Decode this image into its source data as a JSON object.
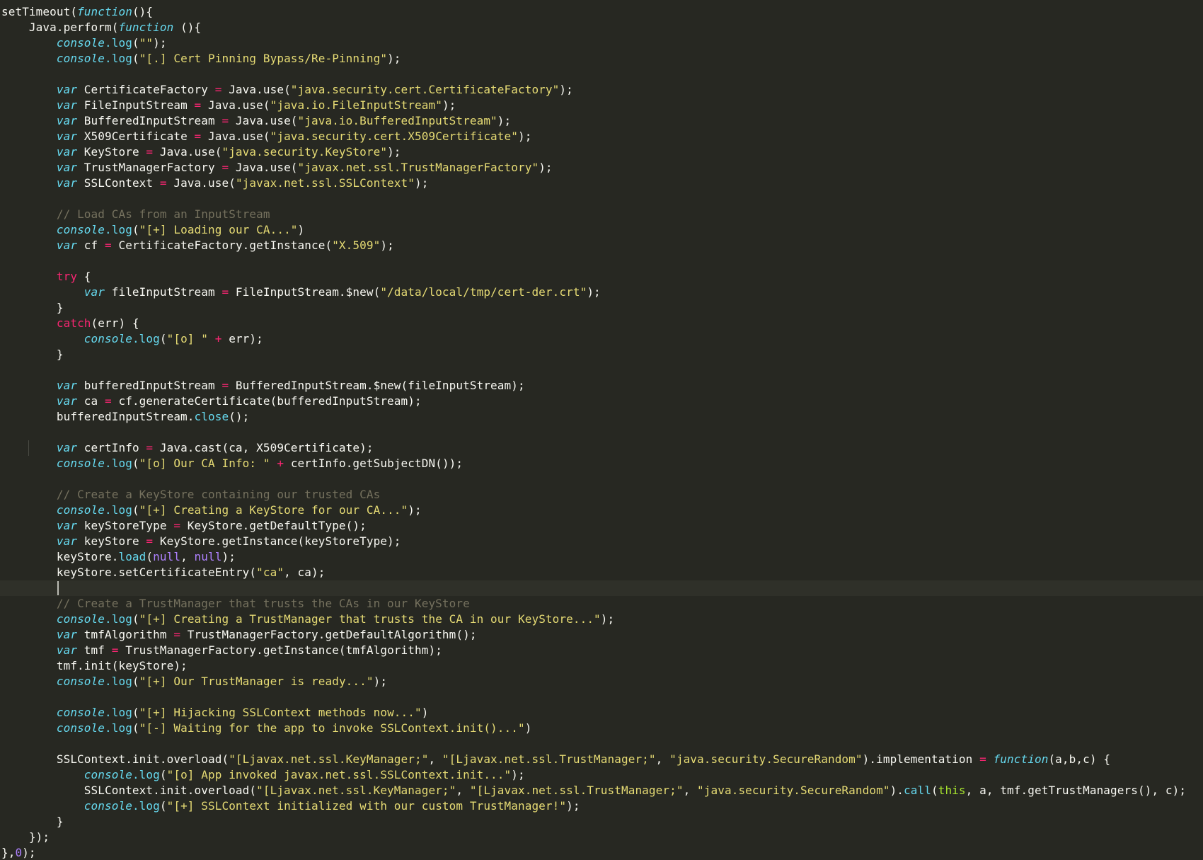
{
  "editor": {
    "theme_colors": {
      "background": "#272822",
      "current_line": "#2f3029",
      "text": "#f8f8f2",
      "string": "#e6db74",
      "storage": "#66d9ef",
      "keyword": "#f92672",
      "comment": "#75715e",
      "constant": "#ae81ff",
      "this": "#a6e22e"
    },
    "current_line_index": 37,
    "lines": [
      [
        [
          "plain",
          "setTimeout("
        ],
        [
          "storage",
          "function"
        ],
        [
          "plain",
          "(){"
        ]
      ],
      [
        [
          "plain",
          "    Java.perform("
        ],
        [
          "storage",
          "function"
        ],
        [
          "plain",
          " (){"
        ]
      ],
      [
        [
          "plain",
          "        "
        ],
        [
          "storage",
          "console"
        ],
        [
          "support",
          ".log"
        ],
        [
          "plain",
          "("
        ],
        [
          "str",
          "\"\""
        ],
        [
          "plain",
          ");"
        ]
      ],
      [
        [
          "plain",
          "        "
        ],
        [
          "storage",
          "console"
        ],
        [
          "support",
          ".log"
        ],
        [
          "plain",
          "("
        ],
        [
          "str",
          "\"[.] Cert Pinning Bypass/Re-Pinning\""
        ],
        [
          "plain",
          ");"
        ]
      ],
      [],
      [
        [
          "plain",
          "        "
        ],
        [
          "storage",
          "var"
        ],
        [
          "plain",
          " CertificateFactory "
        ],
        [
          "op",
          "="
        ],
        [
          "plain",
          " Java.use("
        ],
        [
          "str",
          "\"java.security.cert.CertificateFactory\""
        ],
        [
          "plain",
          ");"
        ]
      ],
      [
        [
          "plain",
          "        "
        ],
        [
          "storage",
          "var"
        ],
        [
          "plain",
          " FileInputStream "
        ],
        [
          "op",
          "="
        ],
        [
          "plain",
          " Java.use("
        ],
        [
          "str",
          "\"java.io.FileInputStream\""
        ],
        [
          "plain",
          ");"
        ]
      ],
      [
        [
          "plain",
          "        "
        ],
        [
          "storage",
          "var"
        ],
        [
          "plain",
          " BufferedInputStream "
        ],
        [
          "op",
          "="
        ],
        [
          "plain",
          " Java.use("
        ],
        [
          "str",
          "\"java.io.BufferedInputStream\""
        ],
        [
          "plain",
          ");"
        ]
      ],
      [
        [
          "plain",
          "        "
        ],
        [
          "storage",
          "var"
        ],
        [
          "plain",
          " X509Certificate "
        ],
        [
          "op",
          "="
        ],
        [
          "plain",
          " Java.use("
        ],
        [
          "str",
          "\"java.security.cert.X509Certificate\""
        ],
        [
          "plain",
          ");"
        ]
      ],
      [
        [
          "plain",
          "        "
        ],
        [
          "storage",
          "var"
        ],
        [
          "plain",
          " KeyStore "
        ],
        [
          "op",
          "="
        ],
        [
          "plain",
          " Java.use("
        ],
        [
          "str",
          "\"java.security.KeyStore\""
        ],
        [
          "plain",
          ");"
        ]
      ],
      [
        [
          "plain",
          "        "
        ],
        [
          "storage",
          "var"
        ],
        [
          "plain",
          " TrustManagerFactory "
        ],
        [
          "op",
          "="
        ],
        [
          "plain",
          " Java.use("
        ],
        [
          "str",
          "\"javax.net.ssl.TrustManagerFactory\""
        ],
        [
          "plain",
          ");"
        ]
      ],
      [
        [
          "plain",
          "        "
        ],
        [
          "storage",
          "var"
        ],
        [
          "plain",
          " SSLContext "
        ],
        [
          "op",
          "="
        ],
        [
          "plain",
          " Java.use("
        ],
        [
          "str",
          "\"javax.net.ssl.SSLContext\""
        ],
        [
          "plain",
          ");"
        ]
      ],
      [],
      [
        [
          "plain",
          "        "
        ],
        [
          "comment",
          "// Load CAs from an InputStream"
        ]
      ],
      [
        [
          "plain",
          "        "
        ],
        [
          "storage",
          "console"
        ],
        [
          "support",
          ".log"
        ],
        [
          "plain",
          "("
        ],
        [
          "str",
          "\"[+] Loading our CA...\""
        ],
        [
          "plain",
          ")"
        ]
      ],
      [
        [
          "plain",
          "        "
        ],
        [
          "storage",
          "var"
        ],
        [
          "plain",
          " cf "
        ],
        [
          "op",
          "="
        ],
        [
          "plain",
          " CertificateFactory.getInstance("
        ],
        [
          "str",
          "\"X.509\""
        ],
        [
          "plain",
          ");"
        ]
      ],
      [],
      [
        [
          "plain",
          "        "
        ],
        [
          "keyword",
          "try"
        ],
        [
          "plain",
          " {"
        ]
      ],
      [
        [
          "plain",
          "            "
        ],
        [
          "storage",
          "var"
        ],
        [
          "plain",
          " fileInputStream "
        ],
        [
          "op",
          "="
        ],
        [
          "plain",
          " FileInputStream.$new("
        ],
        [
          "str",
          "\"/data/local/tmp/cert-der.crt\""
        ],
        [
          "plain",
          ");"
        ]
      ],
      [
        [
          "plain",
          "        }"
        ]
      ],
      [
        [
          "plain",
          "        "
        ],
        [
          "keyword",
          "catch"
        ],
        [
          "plain",
          "(err) {"
        ]
      ],
      [
        [
          "plain",
          "            "
        ],
        [
          "storage",
          "console"
        ],
        [
          "support",
          ".log"
        ],
        [
          "plain",
          "("
        ],
        [
          "str",
          "\"[o] \""
        ],
        [
          "plain",
          " "
        ],
        [
          "op",
          "+"
        ],
        [
          "plain",
          " err);"
        ]
      ],
      [
        [
          "plain",
          "        }"
        ]
      ],
      [],
      [
        [
          "plain",
          "        "
        ],
        [
          "storage",
          "var"
        ],
        [
          "plain",
          " bufferedInputStream "
        ],
        [
          "op",
          "="
        ],
        [
          "plain",
          " BufferedInputStream.$new(fileInputStream);"
        ]
      ],
      [
        [
          "plain",
          "        "
        ],
        [
          "storage",
          "var"
        ],
        [
          "plain",
          " ca "
        ],
        [
          "op",
          "="
        ],
        [
          "plain",
          " cf.generateCertificate(bufferedInputStream);"
        ]
      ],
      [
        [
          "plain",
          "        bufferedInputStream."
        ],
        [
          "support",
          "close"
        ],
        [
          "plain",
          "();"
        ]
      ],
      [],
      [
        [
          "plain",
          "        "
        ],
        [
          "storage",
          "var"
        ],
        [
          "plain",
          " certInfo "
        ],
        [
          "op",
          "="
        ],
        [
          "plain",
          " Java.cast(ca, X509Certificate);"
        ]
      ],
      [
        [
          "plain",
          "        "
        ],
        [
          "storage",
          "console"
        ],
        [
          "support",
          ".log"
        ],
        [
          "plain",
          "("
        ],
        [
          "str",
          "\"[o] Our CA Info: \""
        ],
        [
          "plain",
          " "
        ],
        [
          "op",
          "+"
        ],
        [
          "plain",
          " certInfo.getSubjectDN());"
        ]
      ],
      [],
      [
        [
          "plain",
          "        "
        ],
        [
          "comment",
          "// Create a KeyStore containing our trusted CAs"
        ]
      ],
      [
        [
          "plain",
          "        "
        ],
        [
          "storage",
          "console"
        ],
        [
          "support",
          ".log"
        ],
        [
          "plain",
          "("
        ],
        [
          "str",
          "\"[+] Creating a KeyStore for our CA...\""
        ],
        [
          "plain",
          ");"
        ]
      ],
      [
        [
          "plain",
          "        "
        ],
        [
          "storage",
          "var"
        ],
        [
          "plain",
          " keyStoreType "
        ],
        [
          "op",
          "="
        ],
        [
          "plain",
          " KeyStore.getDefaultType();"
        ]
      ],
      [
        [
          "plain",
          "        "
        ],
        [
          "storage",
          "var"
        ],
        [
          "plain",
          " keyStore "
        ],
        [
          "op",
          "="
        ],
        [
          "plain",
          " KeyStore.getInstance(keyStoreType);"
        ]
      ],
      [
        [
          "plain",
          "        keyStore."
        ],
        [
          "support",
          "load"
        ],
        [
          "plain",
          "("
        ],
        [
          "const",
          "null"
        ],
        [
          "plain",
          ", "
        ],
        [
          "const",
          "null"
        ],
        [
          "plain",
          ");"
        ]
      ],
      [
        [
          "plain",
          "        keyStore.setCertificateEntry("
        ],
        [
          "str",
          "\"ca\""
        ],
        [
          "plain",
          ", ca);"
        ]
      ],
      [],
      [
        [
          "plain",
          "        "
        ],
        [
          "comment",
          "// Create a TrustManager that trusts the CAs in our KeyStore"
        ]
      ],
      [
        [
          "plain",
          "        "
        ],
        [
          "storage",
          "console"
        ],
        [
          "support",
          ".log"
        ],
        [
          "plain",
          "("
        ],
        [
          "str",
          "\"[+] Creating a TrustManager that trusts the CA in our KeyStore...\""
        ],
        [
          "plain",
          ");"
        ]
      ],
      [
        [
          "plain",
          "        "
        ],
        [
          "storage",
          "var"
        ],
        [
          "plain",
          " tmfAlgorithm "
        ],
        [
          "op",
          "="
        ],
        [
          "plain",
          " TrustManagerFactory.getDefaultAlgorithm();"
        ]
      ],
      [
        [
          "plain",
          "        "
        ],
        [
          "storage",
          "var"
        ],
        [
          "plain",
          " tmf "
        ],
        [
          "op",
          "="
        ],
        [
          "plain",
          " TrustManagerFactory.getInstance(tmfAlgorithm);"
        ]
      ],
      [
        [
          "plain",
          "        tmf.init(keyStore);"
        ]
      ],
      [
        [
          "plain",
          "        "
        ],
        [
          "storage",
          "console"
        ],
        [
          "support",
          ".log"
        ],
        [
          "plain",
          "("
        ],
        [
          "str",
          "\"[+] Our TrustManager is ready...\""
        ],
        [
          "plain",
          ");"
        ]
      ],
      [],
      [
        [
          "plain",
          "        "
        ],
        [
          "storage",
          "console"
        ],
        [
          "support",
          ".log"
        ],
        [
          "plain",
          "("
        ],
        [
          "str",
          "\"[+] Hijacking SSLContext methods now...\""
        ],
        [
          "plain",
          ")"
        ]
      ],
      [
        [
          "plain",
          "        "
        ],
        [
          "storage",
          "console"
        ],
        [
          "support",
          ".log"
        ],
        [
          "plain",
          "("
        ],
        [
          "str",
          "\"[-] Waiting for the app to invoke SSLContext.init()...\""
        ],
        [
          "plain",
          ")"
        ]
      ],
      [],
      [
        [
          "plain",
          "        SSLContext.init.overload("
        ],
        [
          "str",
          "\"[Ljavax.net.ssl.KeyManager;\""
        ],
        [
          "plain",
          ", "
        ],
        [
          "str",
          "\"[Ljavax.net.ssl.TrustManager;\""
        ],
        [
          "plain",
          ", "
        ],
        [
          "str",
          "\"java.security.SecureRandom\""
        ],
        [
          "plain",
          ").implementation "
        ],
        [
          "op",
          "="
        ],
        [
          "plain",
          " "
        ],
        [
          "storage",
          "function"
        ],
        [
          "plain",
          "(a,b,c) {"
        ]
      ],
      [
        [
          "plain",
          "            "
        ],
        [
          "storage",
          "console"
        ],
        [
          "support",
          ".log"
        ],
        [
          "plain",
          "("
        ],
        [
          "str",
          "\"[o] App invoked javax.net.ssl.SSLContext.init...\""
        ],
        [
          "plain",
          ");"
        ]
      ],
      [
        [
          "plain",
          "            SSLContext.init.overload("
        ],
        [
          "str",
          "\"[Ljavax.net.ssl.KeyManager;\""
        ],
        [
          "plain",
          ", "
        ],
        [
          "str",
          "\"[Ljavax.net.ssl.TrustManager;\""
        ],
        [
          "plain",
          ", "
        ],
        [
          "str",
          "\"java.security.SecureRandom\""
        ],
        [
          "plain",
          ")."
        ],
        [
          "support",
          "call"
        ],
        [
          "plain",
          "("
        ],
        [
          "this",
          "this"
        ],
        [
          "plain",
          ", a, tmf.getTrustManagers(), c);"
        ]
      ],
      [
        [
          "plain",
          "            "
        ],
        [
          "storage",
          "console"
        ],
        [
          "support",
          ".log"
        ],
        [
          "plain",
          "("
        ],
        [
          "str",
          "\"[+] SSLContext initialized with our custom TrustManager!\""
        ],
        [
          "plain",
          ");"
        ]
      ],
      [
        [
          "plain",
          "        }"
        ]
      ],
      [
        [
          "plain",
          "    });"
        ]
      ],
      [
        [
          "plain",
          "},"
        ],
        [
          "const",
          "0"
        ],
        [
          "plain",
          ");"
        ]
      ]
    ]
  }
}
